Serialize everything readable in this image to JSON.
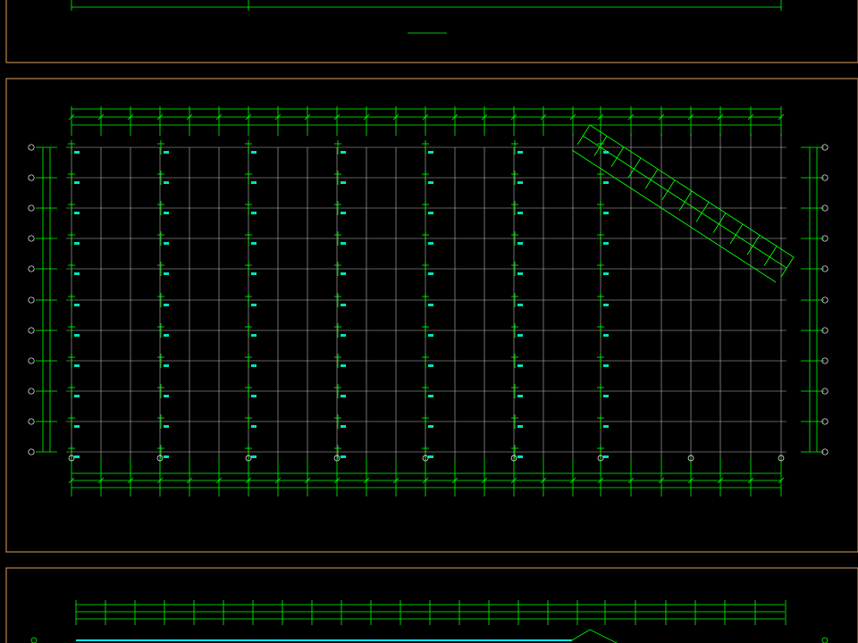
{
  "colors": {
    "background": "#000000",
    "frame": "#b8864b",
    "dimension": "#00ff00",
    "grid": "#c8c8c8",
    "label": "#00e5c0",
    "axis_bubble": "#ffffff",
    "highlight": "#00e5ff"
  },
  "sheets": [
    {
      "id": "top",
      "drawing_title": ""
    },
    {
      "id": "middle",
      "drawing_title": ""
    },
    {
      "id": "bottom",
      "drawing_title": ""
    }
  ]
}
